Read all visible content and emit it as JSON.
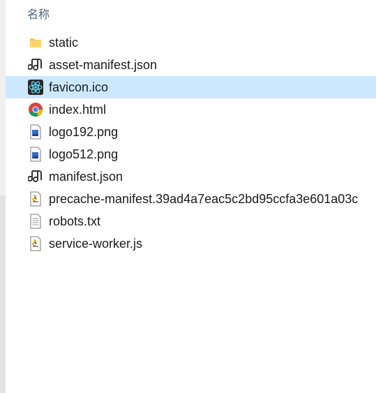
{
  "header": {
    "name_column": "名称"
  },
  "files": [
    {
      "name": "static",
      "icon": "folder-icon",
      "selected": false
    },
    {
      "name": "asset-manifest.json",
      "icon": "json-file-icon",
      "selected": false
    },
    {
      "name": "favicon.ico",
      "icon": "react-icon",
      "selected": true
    },
    {
      "name": "index.html",
      "icon": "chrome-icon",
      "selected": false
    },
    {
      "name": "logo192.png",
      "icon": "image-file-icon",
      "selected": false
    },
    {
      "name": "logo512.png",
      "icon": "image-file-icon",
      "selected": false
    },
    {
      "name": "manifest.json",
      "icon": "json-file-icon",
      "selected": false
    },
    {
      "name": "precache-manifest.39ad4a7eac5c2bd95ccfa3e601a03c",
      "icon": "js-file-icon",
      "selected": false
    },
    {
      "name": "robots.txt",
      "icon": "text-file-icon",
      "selected": false
    },
    {
      "name": "service-worker.js",
      "icon": "js-file-icon",
      "selected": false
    }
  ],
  "colors": {
    "selection": "#cce8ff",
    "header_text": "#4c607a"
  }
}
